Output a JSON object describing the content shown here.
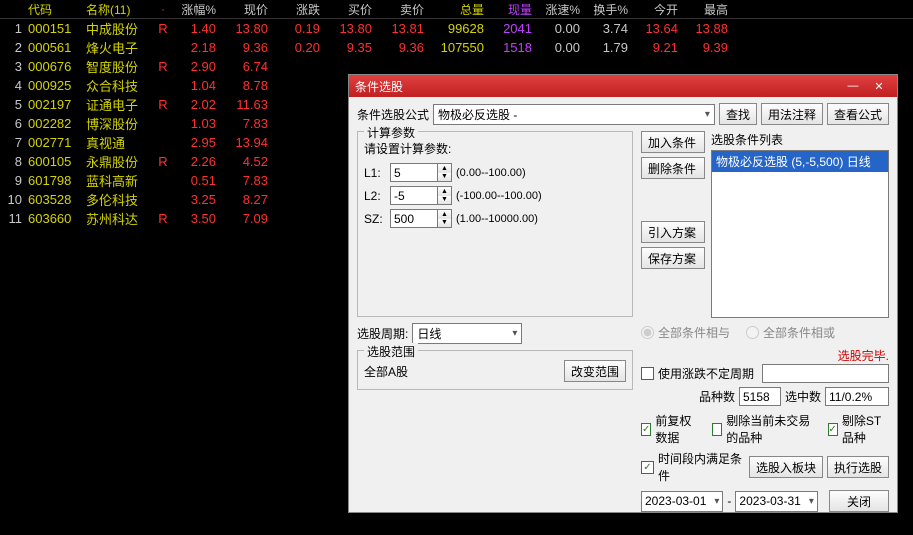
{
  "headers": [
    "代码",
    "名称(11)",
    "涨幅%",
    "现价",
    "涨跌",
    "买价",
    "卖价",
    "总量",
    "现量",
    "涨速%",
    "换手%",
    "今开",
    "最高"
  ],
  "rows": [
    {
      "idx": "1",
      "code": "000151",
      "name": "中成股份",
      "r": "R",
      "pct": "1.40",
      "price": "13.80",
      "chg": "0.19",
      "bid": "13.80",
      "ask": "13.81",
      "vol": "99628",
      "cur": "2041",
      "spd": "0.00",
      "turn": "3.74",
      "open": "13.64",
      "high": "13.88"
    },
    {
      "idx": "2",
      "code": "000561",
      "name": "烽火电子",
      "r": "",
      "pct": "2.18",
      "price": "9.36",
      "chg": "0.20",
      "bid": "9.35",
      "ask": "9.36",
      "vol": "107550",
      "cur": "1518",
      "spd": "0.00",
      "turn": "1.79",
      "open": "9.21",
      "high": "9.39"
    },
    {
      "idx": "3",
      "code": "000676",
      "name": "智度股份",
      "r": "R",
      "pct": "2.90",
      "price": "6.74",
      "chg": "",
      "bid": "",
      "ask": "",
      "vol": "",
      "cur": "",
      "spd": "",
      "turn": "",
      "open": "",
      "high": ""
    },
    {
      "idx": "4",
      "code": "000925",
      "name": "众合科技",
      "r": "",
      "pct": "1.04",
      "price": "8.78",
      "chg": "",
      "bid": "",
      "ask": "",
      "vol": "",
      "cur": "",
      "spd": "",
      "turn": "",
      "open": "",
      "high": ""
    },
    {
      "idx": "5",
      "code": "002197",
      "name": "证通电子",
      "r": "R",
      "pct": "2.02",
      "price": "11.63",
      "chg": "",
      "bid": "",
      "ask": "",
      "vol": "",
      "cur": "",
      "spd": "",
      "turn": "",
      "open": "",
      "high": ""
    },
    {
      "idx": "6",
      "code": "002282",
      "name": "博深股份",
      "r": "",
      "pct": "1.03",
      "price": "7.83",
      "chg": "",
      "bid": "",
      "ask": "",
      "vol": "",
      "cur": "",
      "spd": "",
      "turn": "",
      "open": "",
      "high": ""
    },
    {
      "idx": "7",
      "code": "002771",
      "name": "真视通",
      "r": "",
      "pct": "2.95",
      "price": "13.94",
      "chg": "",
      "bid": "",
      "ask": "",
      "vol": "",
      "cur": "",
      "spd": "",
      "turn": "",
      "open": "",
      "high": ""
    },
    {
      "idx": "8",
      "code": "600105",
      "name": "永鼎股份",
      "r": "R",
      "pct": "2.26",
      "price": "4.52",
      "chg": "",
      "bid": "",
      "ask": "",
      "vol": "",
      "cur": "",
      "spd": "",
      "turn": "",
      "open": "",
      "high": ""
    },
    {
      "idx": "9",
      "code": "601798",
      "name": "蓝科高新",
      "r": "",
      "pct": "0.51",
      "price": "7.83",
      "chg": "",
      "bid": "",
      "ask": "",
      "vol": "",
      "cur": "",
      "spd": "",
      "turn": "",
      "open": "",
      "high": ""
    },
    {
      "idx": "10",
      "code": "603528",
      "name": "多伦科技",
      "r": "",
      "pct": "3.25",
      "price": "8.27",
      "chg": "",
      "bid": "",
      "ask": "",
      "vol": "",
      "cur": "",
      "spd": "",
      "turn": "",
      "open": "",
      "high": ""
    },
    {
      "idx": "11",
      "code": "603660",
      "name": "苏州科达",
      "r": "R",
      "pct": "3.50",
      "price": "7.09",
      "chg": "",
      "bid": "",
      "ask": "",
      "vol": "",
      "cur": "",
      "spd": "",
      "turn": "",
      "open": "",
      "high": ""
    }
  ],
  "dlg": {
    "title": "条件选股",
    "formula_lbl": "条件选股公式",
    "formula_val": "物极必反选股 -",
    "btn_find": "查找",
    "btn_usage": "用法注释",
    "btn_view": "查看公式",
    "fs_calc": "计算参数",
    "calc_hint": "请设置计算参数:",
    "p1": {
      "lbl": "L1:",
      "val": "5",
      "rng": "(0.00--100.00)"
    },
    "p2": {
      "lbl": "L2:",
      "val": "-5",
      "rng": "(-100.00--100.00)"
    },
    "p3": {
      "lbl": "SZ:",
      "val": "500",
      "rng": "(1.00--10000.00)"
    },
    "btn_add": "加入条件",
    "btn_del": "删除条件",
    "btn_load": "引入方案",
    "btn_save": "保存方案",
    "list_title": "选股条件列表",
    "list_item": "物极必反选股 (5,-5,500) 日线",
    "period_lbl": "选股周期:",
    "period_val": "日线",
    "radio_and": "全部条件相与",
    "radio_or": "全部条件相或",
    "done": "选股完毕.",
    "fs_scope": "选股范围",
    "scope_val": "全部A股",
    "btn_scope": "改变范围",
    "chk_uncertain": "使用涨跌不定周期",
    "count_lbl": "品种数",
    "count_val": "5158",
    "hit_lbl": "选中数",
    "hit_val": "11/0.2%",
    "chk_fq": "前复权数据",
    "chk_rm": "剔除当前未交易的品种",
    "chk_st": "剔除ST品种",
    "chk_time": "时间段内满足条件",
    "btn_into": "选股入板块",
    "btn_exec": "执行选股",
    "date_from": "2023-03-01",
    "date_to": "2023-03-31",
    "dash": "-",
    "btn_close": "关闭"
  }
}
